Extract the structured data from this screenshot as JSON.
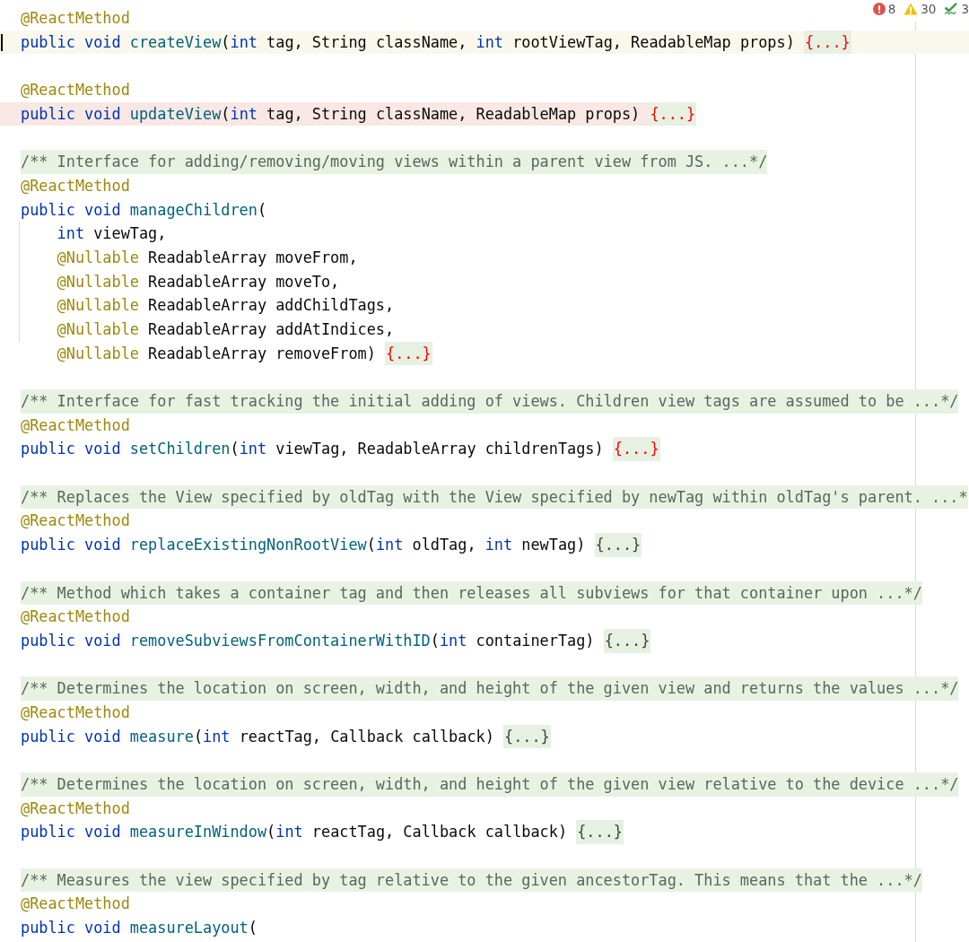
{
  "status": {
    "errors": "8",
    "warnings": "30",
    "checks": "3"
  },
  "lines": [
    {
      "kind": "code",
      "tokens": [
        {
          "kind": "annotation",
          "text": "@ReactMethod"
        }
      ]
    },
    {
      "kind": "code",
      "current_line": true,
      "tokens": [
        {
          "kind": "keyword",
          "text": "public void "
        },
        {
          "kind": "method",
          "text": "createView"
        },
        {
          "kind": "plain",
          "text": "("
        },
        {
          "kind": "keyword",
          "text": "int"
        },
        {
          "kind": "plain",
          "text": " tag, String className, "
        },
        {
          "kind": "keyword",
          "text": "int"
        },
        {
          "kind": "plain",
          "text": " rootViewTag, ReadableMap props) "
        }
      ],
      "fold": {
        "text": "{...}",
        "error": true
      }
    },
    {
      "kind": "blank"
    },
    {
      "kind": "code",
      "tokens": [
        {
          "kind": "annotation",
          "text": "@ReactMethod"
        }
      ]
    },
    {
      "kind": "code",
      "error_line": true,
      "tokens": [
        {
          "kind": "keyword",
          "text": "public void "
        },
        {
          "kind": "method",
          "text": "updateView"
        },
        {
          "kind": "plain",
          "text": "("
        },
        {
          "kind": "keyword",
          "text": "int"
        },
        {
          "kind": "plain",
          "text": " tag, String className, ReadableMap props) "
        }
      ],
      "fold": {
        "text": "{...}",
        "error": true
      }
    },
    {
      "kind": "blank"
    },
    {
      "kind": "comment",
      "text": "/** Interface for adding/removing/moving views within a parent view from JS. ...*/"
    },
    {
      "kind": "code",
      "tokens": [
        {
          "kind": "annotation",
          "text": "@ReactMethod"
        }
      ]
    },
    {
      "kind": "code",
      "tokens": [
        {
          "kind": "keyword",
          "text": "public void "
        },
        {
          "kind": "method",
          "text": "manageChildren"
        },
        {
          "kind": "plain",
          "text": "("
        }
      ]
    },
    {
      "kind": "code",
      "indented": true,
      "indent_guide": true,
      "tokens": [
        {
          "kind": "keyword",
          "text": "int"
        },
        {
          "kind": "plain",
          "text": " viewTag,"
        }
      ]
    },
    {
      "kind": "code",
      "indented": true,
      "indent_guide": true,
      "tokens": [
        {
          "kind": "annotation",
          "text": "@Nullable"
        },
        {
          "kind": "plain",
          "text": " ReadableArray moveFrom,"
        }
      ]
    },
    {
      "kind": "code",
      "indented": true,
      "indent_guide": true,
      "tokens": [
        {
          "kind": "annotation",
          "text": "@Nullable"
        },
        {
          "kind": "plain",
          "text": " ReadableArray moveTo,"
        }
      ]
    },
    {
      "kind": "code",
      "indented": true,
      "indent_guide": true,
      "tokens": [
        {
          "kind": "annotation",
          "text": "@Nullable"
        },
        {
          "kind": "plain",
          "text": " ReadableArray addChildTags,"
        }
      ]
    },
    {
      "kind": "code",
      "indented": true,
      "indent_guide": true,
      "tokens": [
        {
          "kind": "annotation",
          "text": "@Nullable"
        },
        {
          "kind": "plain",
          "text": " ReadableArray addAtIndices,"
        }
      ]
    },
    {
      "kind": "code",
      "indented": true,
      "tokens": [
        {
          "kind": "annotation",
          "text": "@Nullable"
        },
        {
          "kind": "plain",
          "text": " ReadableArray removeFrom) "
        }
      ],
      "fold": {
        "text": "{...}",
        "error": true
      }
    },
    {
      "kind": "blank"
    },
    {
      "kind": "comment",
      "text": "/** Interface for fast tracking the initial adding of views. Children view tags are assumed to be ...*/"
    },
    {
      "kind": "code",
      "tokens": [
        {
          "kind": "annotation",
          "text": "@ReactMethod"
        }
      ]
    },
    {
      "kind": "code",
      "tokens": [
        {
          "kind": "keyword",
          "text": "public void "
        },
        {
          "kind": "method",
          "text": "setChildren"
        },
        {
          "kind": "plain",
          "text": "("
        },
        {
          "kind": "keyword",
          "text": "int"
        },
        {
          "kind": "plain",
          "text": " viewTag, ReadableArray childrenTags) "
        }
      ],
      "fold": {
        "text": "{...}",
        "error": true
      }
    },
    {
      "kind": "blank"
    },
    {
      "kind": "comment",
      "text": "/** Replaces the View specified by oldTag with the View specified by newTag within oldTag's parent. ...*"
    },
    {
      "kind": "code",
      "tokens": [
        {
          "kind": "annotation",
          "text": "@ReactMethod"
        }
      ]
    },
    {
      "kind": "code",
      "tokens": [
        {
          "kind": "keyword",
          "text": "public void "
        },
        {
          "kind": "method",
          "text": "replaceExistingNonRootView"
        },
        {
          "kind": "plain",
          "text": "("
        },
        {
          "kind": "keyword",
          "text": "int"
        },
        {
          "kind": "plain",
          "text": " oldTag, "
        },
        {
          "kind": "keyword",
          "text": "int"
        },
        {
          "kind": "plain",
          "text": " newTag) "
        }
      ],
      "fold": {
        "text": "{...}",
        "error": false
      }
    },
    {
      "kind": "blank"
    },
    {
      "kind": "comment",
      "text": "/** Method which takes a container tag and then releases all subviews for that container upon ...*/"
    },
    {
      "kind": "code",
      "tokens": [
        {
          "kind": "annotation",
          "text": "@ReactMethod"
        }
      ]
    },
    {
      "kind": "code",
      "tokens": [
        {
          "kind": "keyword",
          "text": "public void "
        },
        {
          "kind": "method",
          "text": "removeSubviewsFromContainerWithID"
        },
        {
          "kind": "plain",
          "text": "("
        },
        {
          "kind": "keyword",
          "text": "int"
        },
        {
          "kind": "plain",
          "text": " containerTag) "
        }
      ],
      "fold": {
        "text": "{...}",
        "error": false
      }
    },
    {
      "kind": "blank"
    },
    {
      "kind": "comment",
      "text": "/** Determines the location on screen, width, and height of the given view and returns the values ...*/"
    },
    {
      "kind": "code",
      "tokens": [
        {
          "kind": "annotation",
          "text": "@ReactMethod"
        }
      ]
    },
    {
      "kind": "code",
      "tokens": [
        {
          "kind": "keyword",
          "text": "public void "
        },
        {
          "kind": "method",
          "text": "measure"
        },
        {
          "kind": "plain",
          "text": "("
        },
        {
          "kind": "keyword",
          "text": "int"
        },
        {
          "kind": "plain",
          "text": " reactTag, Callback callback) "
        }
      ],
      "fold": {
        "text": "{...}",
        "error": false
      }
    },
    {
      "kind": "blank"
    },
    {
      "kind": "comment",
      "text": "/** Determines the location on screen, width, and height of the given view relative to the device ...*/"
    },
    {
      "kind": "code",
      "tokens": [
        {
          "kind": "annotation",
          "text": "@ReactMethod"
        }
      ]
    },
    {
      "kind": "code",
      "tokens": [
        {
          "kind": "keyword",
          "text": "public void "
        },
        {
          "kind": "method",
          "text": "measureInWindow"
        },
        {
          "kind": "plain",
          "text": "("
        },
        {
          "kind": "keyword",
          "text": "int"
        },
        {
          "kind": "plain",
          "text": " reactTag, Callback callback) "
        }
      ],
      "fold": {
        "text": "{...}",
        "error": false
      }
    },
    {
      "kind": "blank"
    },
    {
      "kind": "comment",
      "text": "/** Measures the view specified by tag relative to the given ancestorTag. This means that the ...*/"
    },
    {
      "kind": "code",
      "tokens": [
        {
          "kind": "annotation",
          "text": "@ReactMethod"
        }
      ]
    },
    {
      "kind": "code",
      "tokens": [
        {
          "kind": "keyword",
          "text": "public void "
        },
        {
          "kind": "method",
          "text": "measureLayout"
        },
        {
          "kind": "plain",
          "text": "("
        }
      ]
    }
  ]
}
